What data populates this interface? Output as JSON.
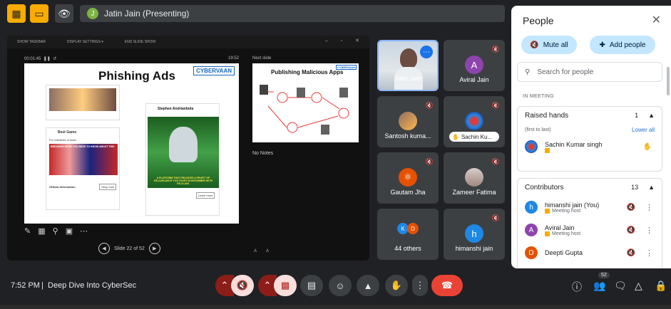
{
  "topbar": {
    "presenter_initial": "J",
    "presenter_label": "Jatin Jain (Presenting)"
  },
  "presentation": {
    "toolbar": [
      "SHOW TASKBAR",
      "DISPLAY SETTINGS ▾",
      "END SLIDE SHOW"
    ],
    "elapsed": "00:01:45",
    "clock": "19:52",
    "next_slide_label": "Next slide",
    "slide_title": "Phishing Ads",
    "logo_text": "CYBERVAAN",
    "card1_title": "Best Game",
    "card1_sub": "For residents of India",
    "card1_banner": "BREAKING NEWS YOU NEED TO KNOW ABOUT THIS",
    "card1_info": "Official Information",
    "card1_btn": "Shop now",
    "card2_title": "Stephen Andrianbola",
    "card2_promo": "A PLATFORM THAT PROVIDES A PROFIT OF RS.2,800,000 IF YOU START IN DECEMBER WITH RS.21,000.",
    "card2_learn": "Learn more",
    "next_slide_title": "Publishing Malicious Apps",
    "next_logo": "CYBERVAAN",
    "no_notes": "No Notes",
    "slide_counter": "Slide 22 of 52"
  },
  "tiles": [
    {
      "name": "Jatin Jain"
    },
    {
      "name": "Aviral Jain",
      "initial": "A",
      "color": "#8e44ad"
    },
    {
      "name": "Santosh kuma..."
    },
    {
      "name": "Sachin Ku..."
    },
    {
      "name": "Gautam Jha"
    },
    {
      "name": "Zameer Fatima"
    },
    {
      "name": "44 others",
      "initials": [
        "K",
        "D"
      ]
    },
    {
      "name": "himanshi jain",
      "initial": "h",
      "color": "#1e88e5"
    }
  ],
  "people": {
    "title": "People",
    "mute_all": "Mute all",
    "add_people": "Add people",
    "search_placeholder": "Search for people",
    "in_meeting": "IN MEETING",
    "raised_hands": {
      "label": "Raised hands",
      "count": "1",
      "order": "(first to last)",
      "lower_all": "Lower all"
    },
    "raised_person": {
      "name": "Sachin Kumar singh"
    },
    "contributors": {
      "label": "Contributors",
      "count": "13"
    },
    "members": [
      {
        "initial": "h",
        "name": "himanshi jain (You)",
        "role": "Meeting host",
        "color": "#1e88e5"
      },
      {
        "initial": "A",
        "name": "Aviral Jain",
        "role": "Meeting host",
        "color": "#8e44ad"
      },
      {
        "initial": "D",
        "name": "Deepti Gupta",
        "role": "",
        "color": "#e65100"
      }
    ]
  },
  "bottombar": {
    "clock": "7:52 PM",
    "separator": "|",
    "meeting_name": "Deep Dive Into CyberSec",
    "people_badge": "52"
  }
}
